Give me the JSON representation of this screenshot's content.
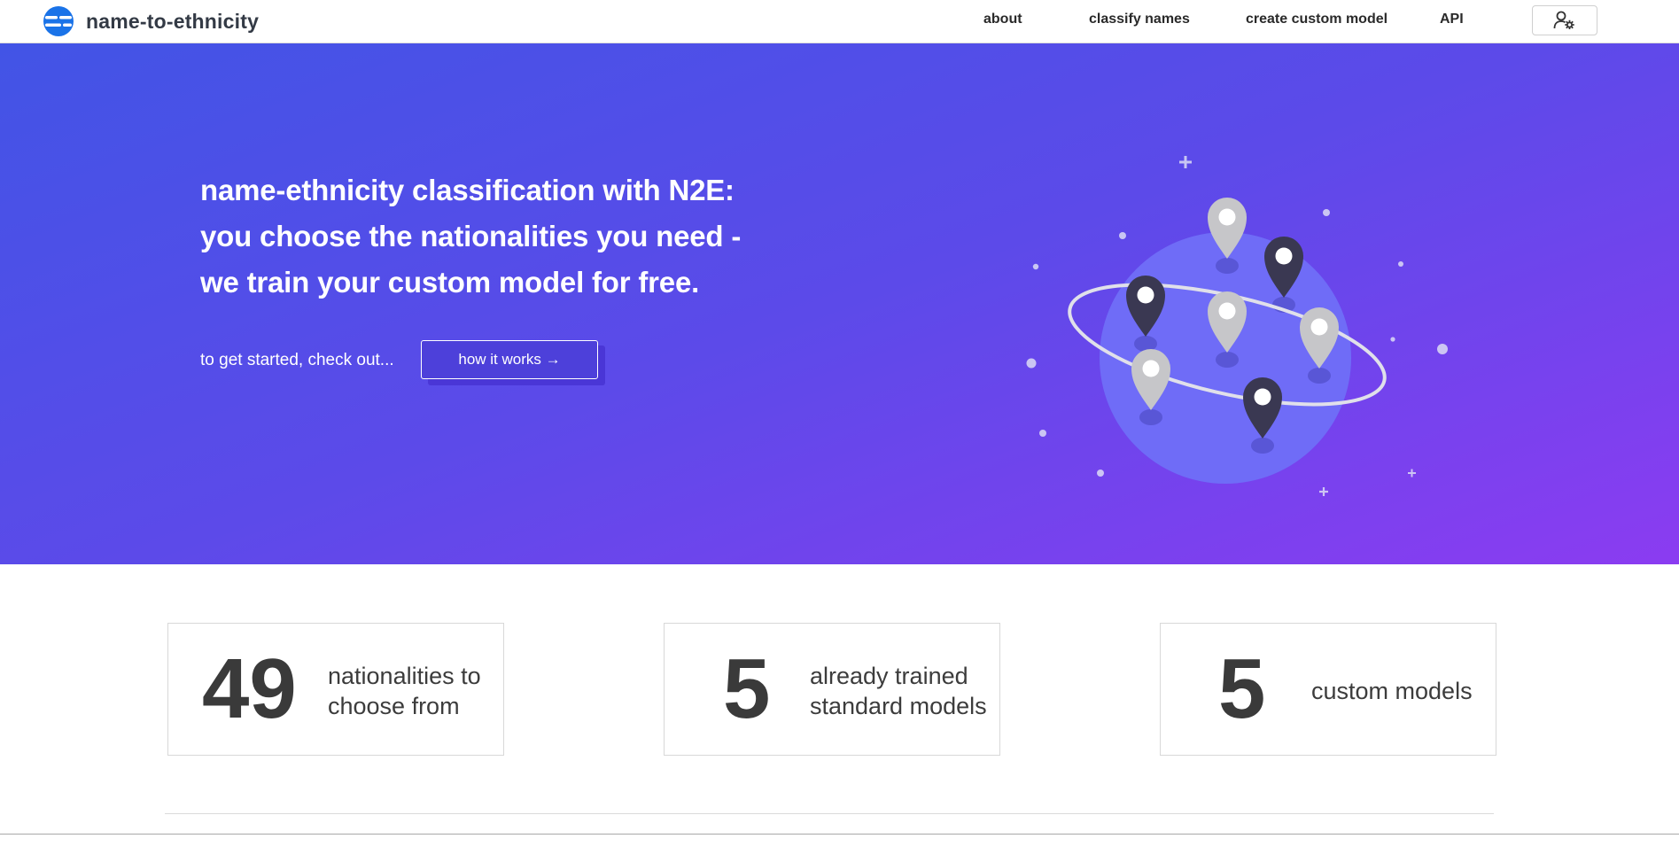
{
  "nav": {
    "brand": "name-to-ethnicity",
    "links": [
      "about",
      "classify names",
      "create custom model",
      "API"
    ]
  },
  "hero": {
    "heading_lines": [
      "name-ethnicity classification with N2E:",
      "you choose the nationalities you need -",
      "we train your custom model for free."
    ],
    "cta_text": "to get started, check out...",
    "cta_button": "how it works →"
  },
  "stats": [
    {
      "number": "49",
      "label": "nationalities to choose from"
    },
    {
      "number": "5",
      "label": "already trained standard models"
    },
    {
      "number": "5",
      "label": "custom models"
    }
  ],
  "colors": {
    "brand_blue": "#1a73e8",
    "hero_gradient_start": "#4254e6",
    "hero_gradient_end": "#8b3cf1",
    "globe": "#6f6cf7",
    "pin_light": "#c6c6c9",
    "pin_dark": "#3a3852"
  },
  "icons": {
    "brand": "n2e-logo-icon",
    "user": "user-settings-icon",
    "illustration": "globe-with-location-pins-illustration"
  }
}
